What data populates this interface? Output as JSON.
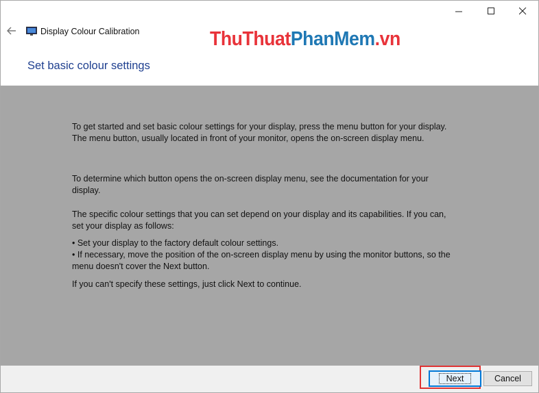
{
  "window": {
    "title": "Display Colour Calibration",
    "controls": {
      "minimize_icon": "minimize-icon",
      "maximize_icon": "maximize-icon",
      "close_icon": "close-icon"
    }
  },
  "watermark": {
    "part1": "ThuThuat",
    "part2": "PhanMem",
    "part3": ".vn"
  },
  "page": {
    "heading": "Set basic colour settings",
    "paragraphs": [
      "To get started and set basic colour settings for your display, press the menu button for your display. The menu button, usually located in front of your monitor, opens the on-screen display menu.",
      "To determine which button opens the on-screen display menu, see the documentation for your display.",
      "The specific colour settings that you can set depend on your display and its capabilities. If you can, set your display as follows:"
    ],
    "bullets": [
      "• Set your display to the factory default colour settings.",
      "• If necessary, move the position of the on-screen display menu by using the monitor buttons, so the menu doesn't cover the Next button."
    ],
    "closing": "If you can't specify these settings,  just click Next to continue."
  },
  "buttons": {
    "next": "Next",
    "cancel": "Cancel"
  },
  "colors": {
    "heading": "#1e3f8f",
    "content_bg": "#a6a6a6",
    "highlight": "#e03232",
    "focus": "#0078d7"
  }
}
